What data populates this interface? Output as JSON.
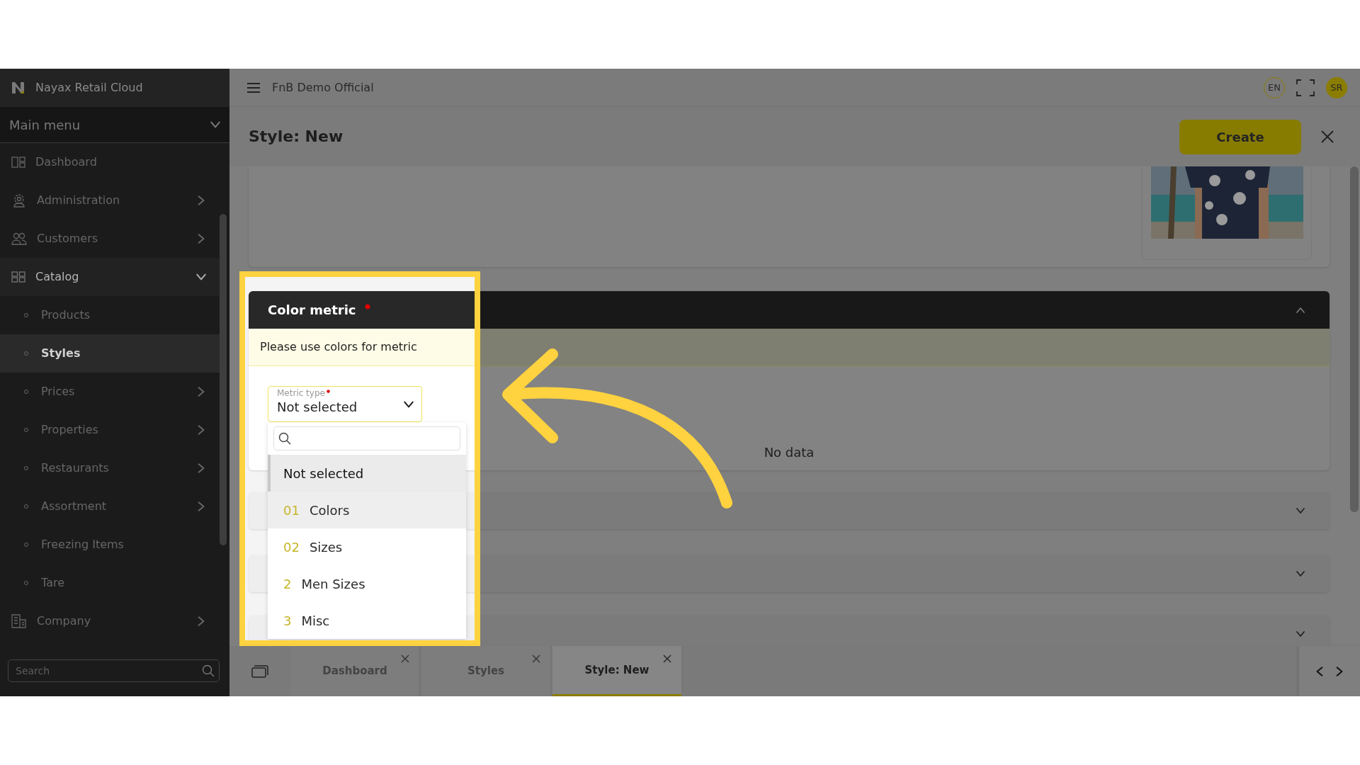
{
  "sidebar": {
    "brand": "Nayax Retail Cloud",
    "menu_title": "Main menu",
    "items": [
      {
        "label": "Dashboard",
        "kind": "link",
        "selected": false
      },
      {
        "label": "Administration",
        "kind": "folder",
        "expanded": false,
        "selected": false
      },
      {
        "label": "Customers",
        "kind": "folder",
        "expanded": false,
        "selected": false
      },
      {
        "label": "Catalog",
        "kind": "folder",
        "expanded": true,
        "selected": false,
        "children": [
          {
            "label": "Products",
            "kind": "link",
            "selected": false
          },
          {
            "label": "Styles",
            "kind": "link",
            "selected": true
          },
          {
            "label": "Prices",
            "kind": "folder",
            "expanded": false,
            "selected": false
          },
          {
            "label": "Properties",
            "kind": "folder",
            "expanded": false,
            "selected": false
          },
          {
            "label": "Restaurants",
            "kind": "folder",
            "expanded": false,
            "selected": false
          },
          {
            "label": "Assortment",
            "kind": "folder",
            "expanded": false,
            "selected": false
          },
          {
            "label": "Freezing Items",
            "kind": "link",
            "selected": false
          },
          {
            "label": "Tare",
            "kind": "link",
            "selected": false
          }
        ]
      },
      {
        "label": "Company",
        "kind": "folder",
        "expanded": false,
        "selected": false
      }
    ],
    "search": {
      "placeholder": "Search"
    }
  },
  "topbar": {
    "company": "FnB Demo Official",
    "language": "EN",
    "user_initials": "SR"
  },
  "page": {
    "title": "Style: New",
    "create_button": "Create"
  },
  "color_metric": {
    "title": "Color metric",
    "required": true,
    "hint": "Please use colors for metric",
    "empty_text": "No data",
    "expanded": true,
    "metric_type": {
      "label": "Metric type",
      "required": true,
      "value": "Not selected",
      "open": true
    },
    "options": [
      {
        "label": "Not selected",
        "selected": true,
        "hovered": false
      },
      {
        "code": "01",
        "label": "Colors",
        "selected": false,
        "hovered": true
      },
      {
        "code": "02",
        "label": "Sizes",
        "selected": false,
        "hovered": false
      },
      {
        "code": "2",
        "label": "Men Sizes",
        "selected": false,
        "hovered": false
      },
      {
        "code": "3",
        "label": "Misc",
        "selected": false,
        "hovered": false
      }
    ]
  },
  "collapsed_sections": [
    {
      "expanded": false
    },
    {
      "expanded": false
    },
    {
      "expanded": false
    }
  ],
  "tabs": [
    {
      "label": "Dashboard",
      "selected": false
    },
    {
      "label": "Styles",
      "selected": false
    },
    {
      "label": "Style: New",
      "selected": true
    }
  ]
}
